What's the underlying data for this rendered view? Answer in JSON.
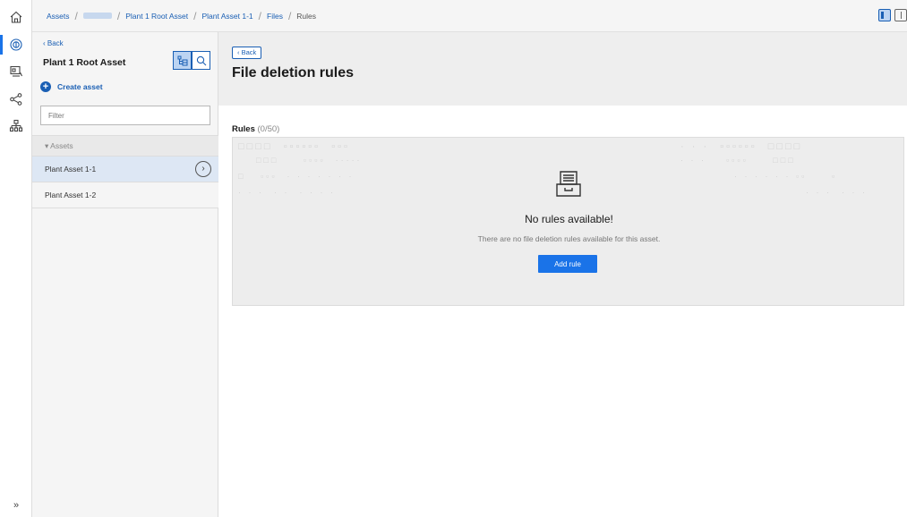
{
  "breadcrumb": {
    "items": [
      "Assets",
      "Plant 1 Root Asset",
      "Plant Asset 1-1",
      "Files",
      "Rules"
    ]
  },
  "rail": {
    "icons": [
      "home-icon",
      "asset-icon",
      "dashboard-icon",
      "share-icon",
      "hierarchy-icon"
    ],
    "expand_label": "»"
  },
  "panel": {
    "back_label": "‹ Back",
    "title": "Plant 1 Root Asset",
    "create_label": "Create asset",
    "filter_placeholder": "Filter",
    "tree_header": "▾ Assets",
    "items": [
      {
        "label": "Plant Asset 1-1",
        "selected": true
      },
      {
        "label": "Plant Asset 1-2",
        "selected": false
      }
    ]
  },
  "main": {
    "back_label": "‹ Back",
    "title": "File deletion rules",
    "rules_label": "Rules",
    "rules_count": "(0/50)",
    "empty_title": "No rules available!",
    "empty_subtitle": "There are no file deletion rules available for this asset.",
    "add_rule_label": "Add rule"
  },
  "colors": {
    "accent": "#1a73e8",
    "link": "#1a5fb4",
    "selected_bg": "#dde7f4"
  }
}
